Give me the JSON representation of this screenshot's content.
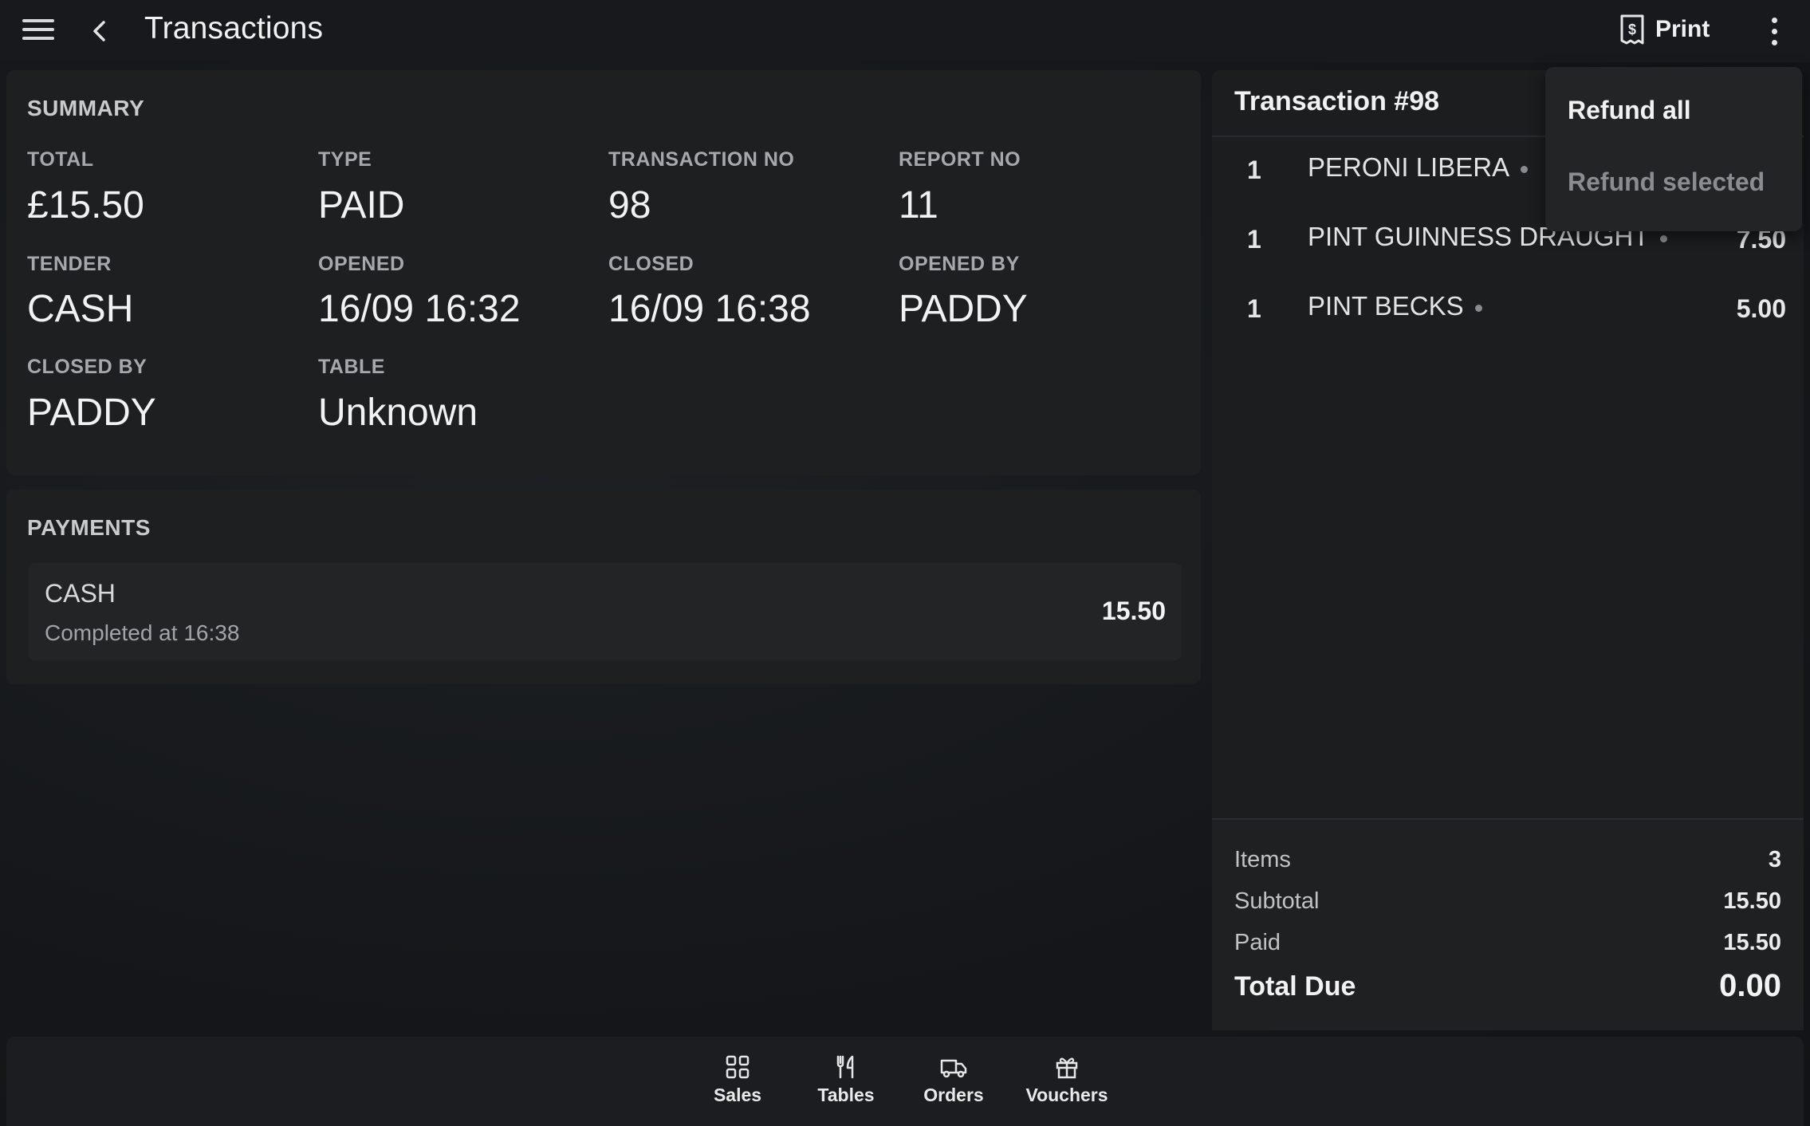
{
  "header": {
    "title": "Transactions",
    "print_label": "Print"
  },
  "summary": {
    "title": "SUMMARY",
    "fields": [
      {
        "label": "TOTAL",
        "value": "£15.50"
      },
      {
        "label": "TYPE",
        "value": "PAID"
      },
      {
        "label": "TRANSACTION NO",
        "value": "98"
      },
      {
        "label": "REPORT NO",
        "value": "11"
      },
      {
        "label": "TENDER",
        "value": "CASH"
      },
      {
        "label": "OPENED",
        "value": "16/09 16:32"
      },
      {
        "label": "CLOSED",
        "value": "16/09 16:38"
      },
      {
        "label": "OPENED BY",
        "value": "PADDY"
      },
      {
        "label": "CLOSED BY",
        "value": "PADDY"
      },
      {
        "label": "TABLE",
        "value": "Unknown"
      }
    ]
  },
  "payments": {
    "title": "PAYMENTS",
    "items": [
      {
        "name": "CASH",
        "status": "Completed at 16:38",
        "amount": "15.50"
      }
    ]
  },
  "transaction": {
    "title": "Transaction #98",
    "lines": [
      {
        "qty": "1",
        "name": "PERONI LIBERA",
        "price": ""
      },
      {
        "qty": "1",
        "name": "PINT GUINNESS DRAUGHT",
        "price": "7.50"
      },
      {
        "qty": "1",
        "name": "PINT BECKS",
        "price": "5.00"
      }
    ],
    "totals": {
      "items_label": "Items",
      "items_value": "3",
      "subtotal_label": "Subtotal",
      "subtotal_value": "15.50",
      "paid_label": "Paid",
      "paid_value": "15.50",
      "due_label": "Total Due",
      "due_value": "0.00"
    }
  },
  "menu": {
    "refund_all": "Refund all",
    "refund_selected": "Refund selected"
  },
  "bottom_nav": [
    {
      "label": "Sales",
      "icon": "grid-icon"
    },
    {
      "label": "Tables",
      "icon": "cutlery-icon"
    },
    {
      "label": "Orders",
      "icon": "delivery-truck-icon"
    },
    {
      "label": "Vouchers",
      "icon": "gift-icon"
    }
  ]
}
